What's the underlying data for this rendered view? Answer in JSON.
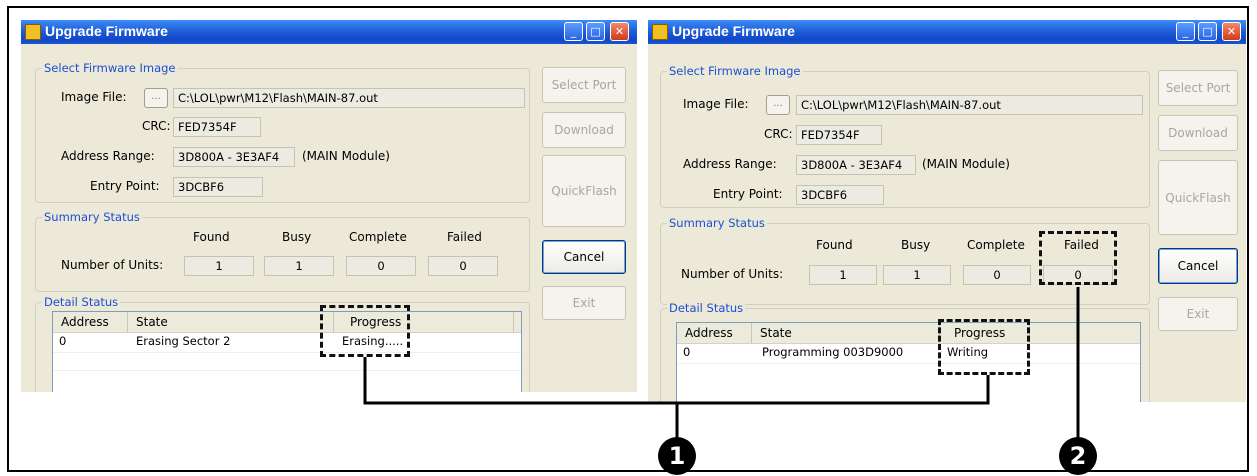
{
  "windows": [
    {
      "title": "Upgrade Firmware",
      "app_icon": "Flash",
      "controls": {
        "minimize": "_",
        "maximize": "□",
        "close": "✕"
      },
      "firmware": {
        "group_label": "Select Firmware Image",
        "image_file_label": "Image File:",
        "browse_label": "...",
        "image_file_value": "C:\\LOL\\pwr\\M12\\Flash\\MAIN-87.out",
        "crc_label": "CRC:",
        "crc_value": "FED7354F",
        "address_range_label": "Address Range:",
        "address_range_value": "3D800A - 3E3AF4",
        "address_range_note": "(MAIN Module)",
        "entry_point_label": "Entry Point:",
        "entry_point_value": "3DCBF6"
      },
      "summary": {
        "group_label": "Summary Status",
        "row_label": "Number of Units:",
        "headers": {
          "found": "Found",
          "busy": "Busy",
          "complete": "Complete",
          "failed": "Failed"
        },
        "values": {
          "found": "1",
          "busy": "1",
          "complete": "0",
          "failed": "0"
        }
      },
      "detail": {
        "group_label": "Detail Status",
        "columns": {
          "address": "Address",
          "state": "State",
          "progress": "Progress"
        },
        "row": {
          "address": "0",
          "state": "Erasing Sector 2",
          "progress": "Erasing....."
        }
      },
      "buttons": {
        "select_port": "Select Port",
        "download": "Download",
        "quickflash": "QuickFlash",
        "cancel": "Cancel",
        "exit": "Exit"
      }
    },
    {
      "title": "Upgrade Firmware",
      "app_icon": "Flash",
      "controls": {
        "minimize": "_",
        "maximize": "□",
        "close": "✕"
      },
      "firmware": {
        "group_label": "Select Firmware Image",
        "image_file_label": "Image File:",
        "browse_label": "...",
        "image_file_value": "C:\\LOL\\pwr\\M12\\Flash\\MAIN-87.out",
        "crc_label": "CRC:",
        "crc_value": "FED7354F",
        "address_range_label": "Address Range:",
        "address_range_value": "3D800A - 3E3AF4",
        "address_range_note": "(MAIN Module)",
        "entry_point_label": "Entry Point:",
        "entry_point_value": "3DCBF6"
      },
      "summary": {
        "group_label": "Summary Status",
        "row_label": "Number of Units:",
        "headers": {
          "found": "Found",
          "busy": "Busy",
          "complete": "Complete",
          "failed": "Failed"
        },
        "values": {
          "found": "1",
          "busy": "1",
          "complete": "0",
          "failed": "0"
        }
      },
      "detail": {
        "group_label": "Detail Status",
        "columns": {
          "address": "Address",
          "state": "State",
          "progress": "Progress"
        },
        "row": {
          "address": "0",
          "state": "Programming 003D9000",
          "progress": "Writing"
        }
      },
      "buttons": {
        "select_port": "Select Port",
        "download": "Download",
        "quickflash": "QuickFlash",
        "cancel": "Cancel",
        "exit": "Exit"
      }
    }
  ],
  "callouts": [
    {
      "number": "1"
    },
    {
      "number": "2"
    }
  ],
  "colors": {
    "titlebar": "#1f5fd8",
    "window_bg": "#ece9d8",
    "group_label": "#1c4fd1"
  }
}
